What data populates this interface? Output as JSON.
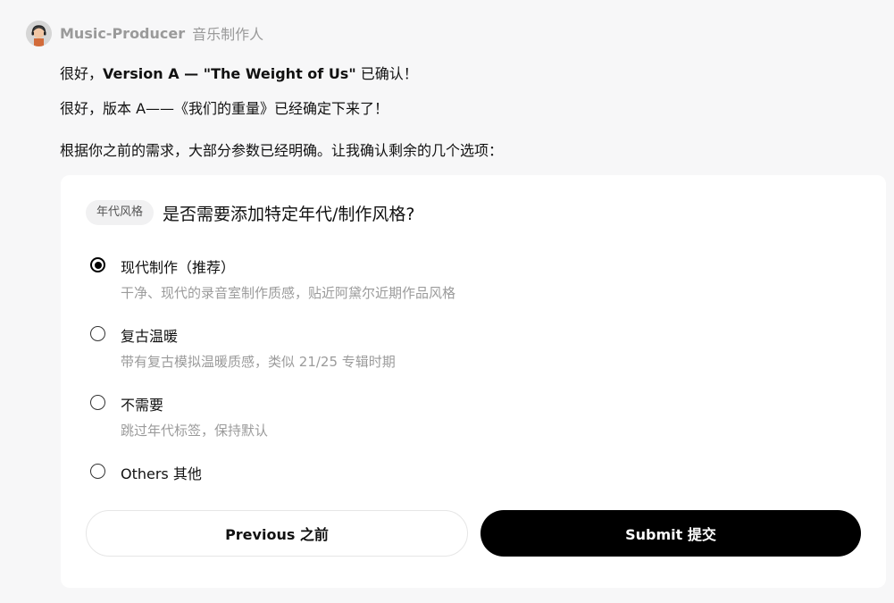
{
  "sender": {
    "name": "Music-Producer",
    "role": "音乐制作人"
  },
  "messages": {
    "line1_prefix": "很好，",
    "line1_bold": "Version A — \"The Weight of Us\"",
    "line1_suffix": " 已确认！",
    "line2": "很好，版本 A——《我们的重量》已经确定下来了！",
    "line3": "根据你之前的需求，大部分参数已经明确。让我确认剩余的几个选项："
  },
  "question": {
    "tag": "年代风格",
    "text": "是否需要添加特定年代/制作风格?"
  },
  "options": [
    {
      "label": "现代制作（推荐）",
      "desc": "干净、现代的录音室制作质感，贴近阿黛尔近期作品风格",
      "selected": true
    },
    {
      "label": "复古温暖",
      "desc": "带有复古模拟温暖质感，类似 21/25 专辑时期",
      "selected": false
    },
    {
      "label": "不需要",
      "desc": "跳过年代标签，保持默认",
      "selected": false
    },
    {
      "label": "Others  其他",
      "desc": "",
      "selected": false
    }
  ],
  "buttons": {
    "previous": "Previous  之前",
    "submit": "Submit  提交"
  },
  "colors": {
    "background": "#f7f7f8",
    "card": "#ffffff",
    "primary_button": "#000000",
    "muted_text": "#9b9b9b"
  }
}
